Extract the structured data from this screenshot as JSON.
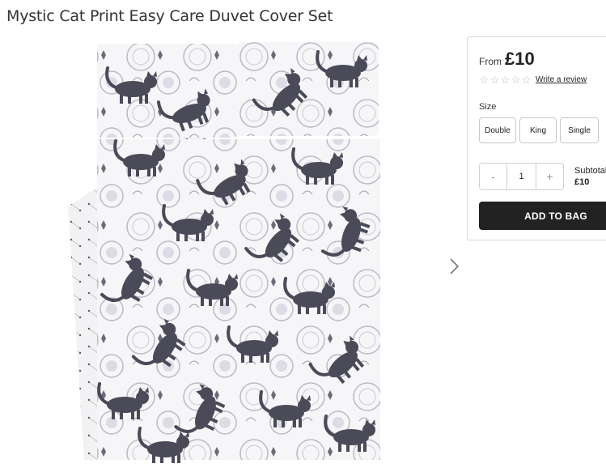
{
  "product": {
    "title": "Mystic Cat Print Easy Care Duvet Cover Set"
  },
  "gallery": {
    "image_alt": "Mystic Cat Print Easy Care Duvet Cover Set",
    "next_icon": "chevron-right-icon"
  },
  "purchase": {
    "from_label": "From",
    "price": "£10",
    "rating_stars": 0,
    "rating_max": 5,
    "star_icon": "star-outline-icon",
    "review_link": "Write a review",
    "size_label": "Size",
    "sizes": [
      "Double",
      "King",
      "Single"
    ],
    "qty_minus": "-",
    "qty_value": "1",
    "qty_plus": "+",
    "subtotal_label": "Subtotal",
    "subtotal_value": "£10",
    "add_to_bag": "ADD TO BAG"
  },
  "colors": {
    "button_dark": "#222222",
    "border": "#d9d9d9",
    "cat_fill": "#4b4b5a",
    "pattern_fill": "#e9eaef"
  }
}
